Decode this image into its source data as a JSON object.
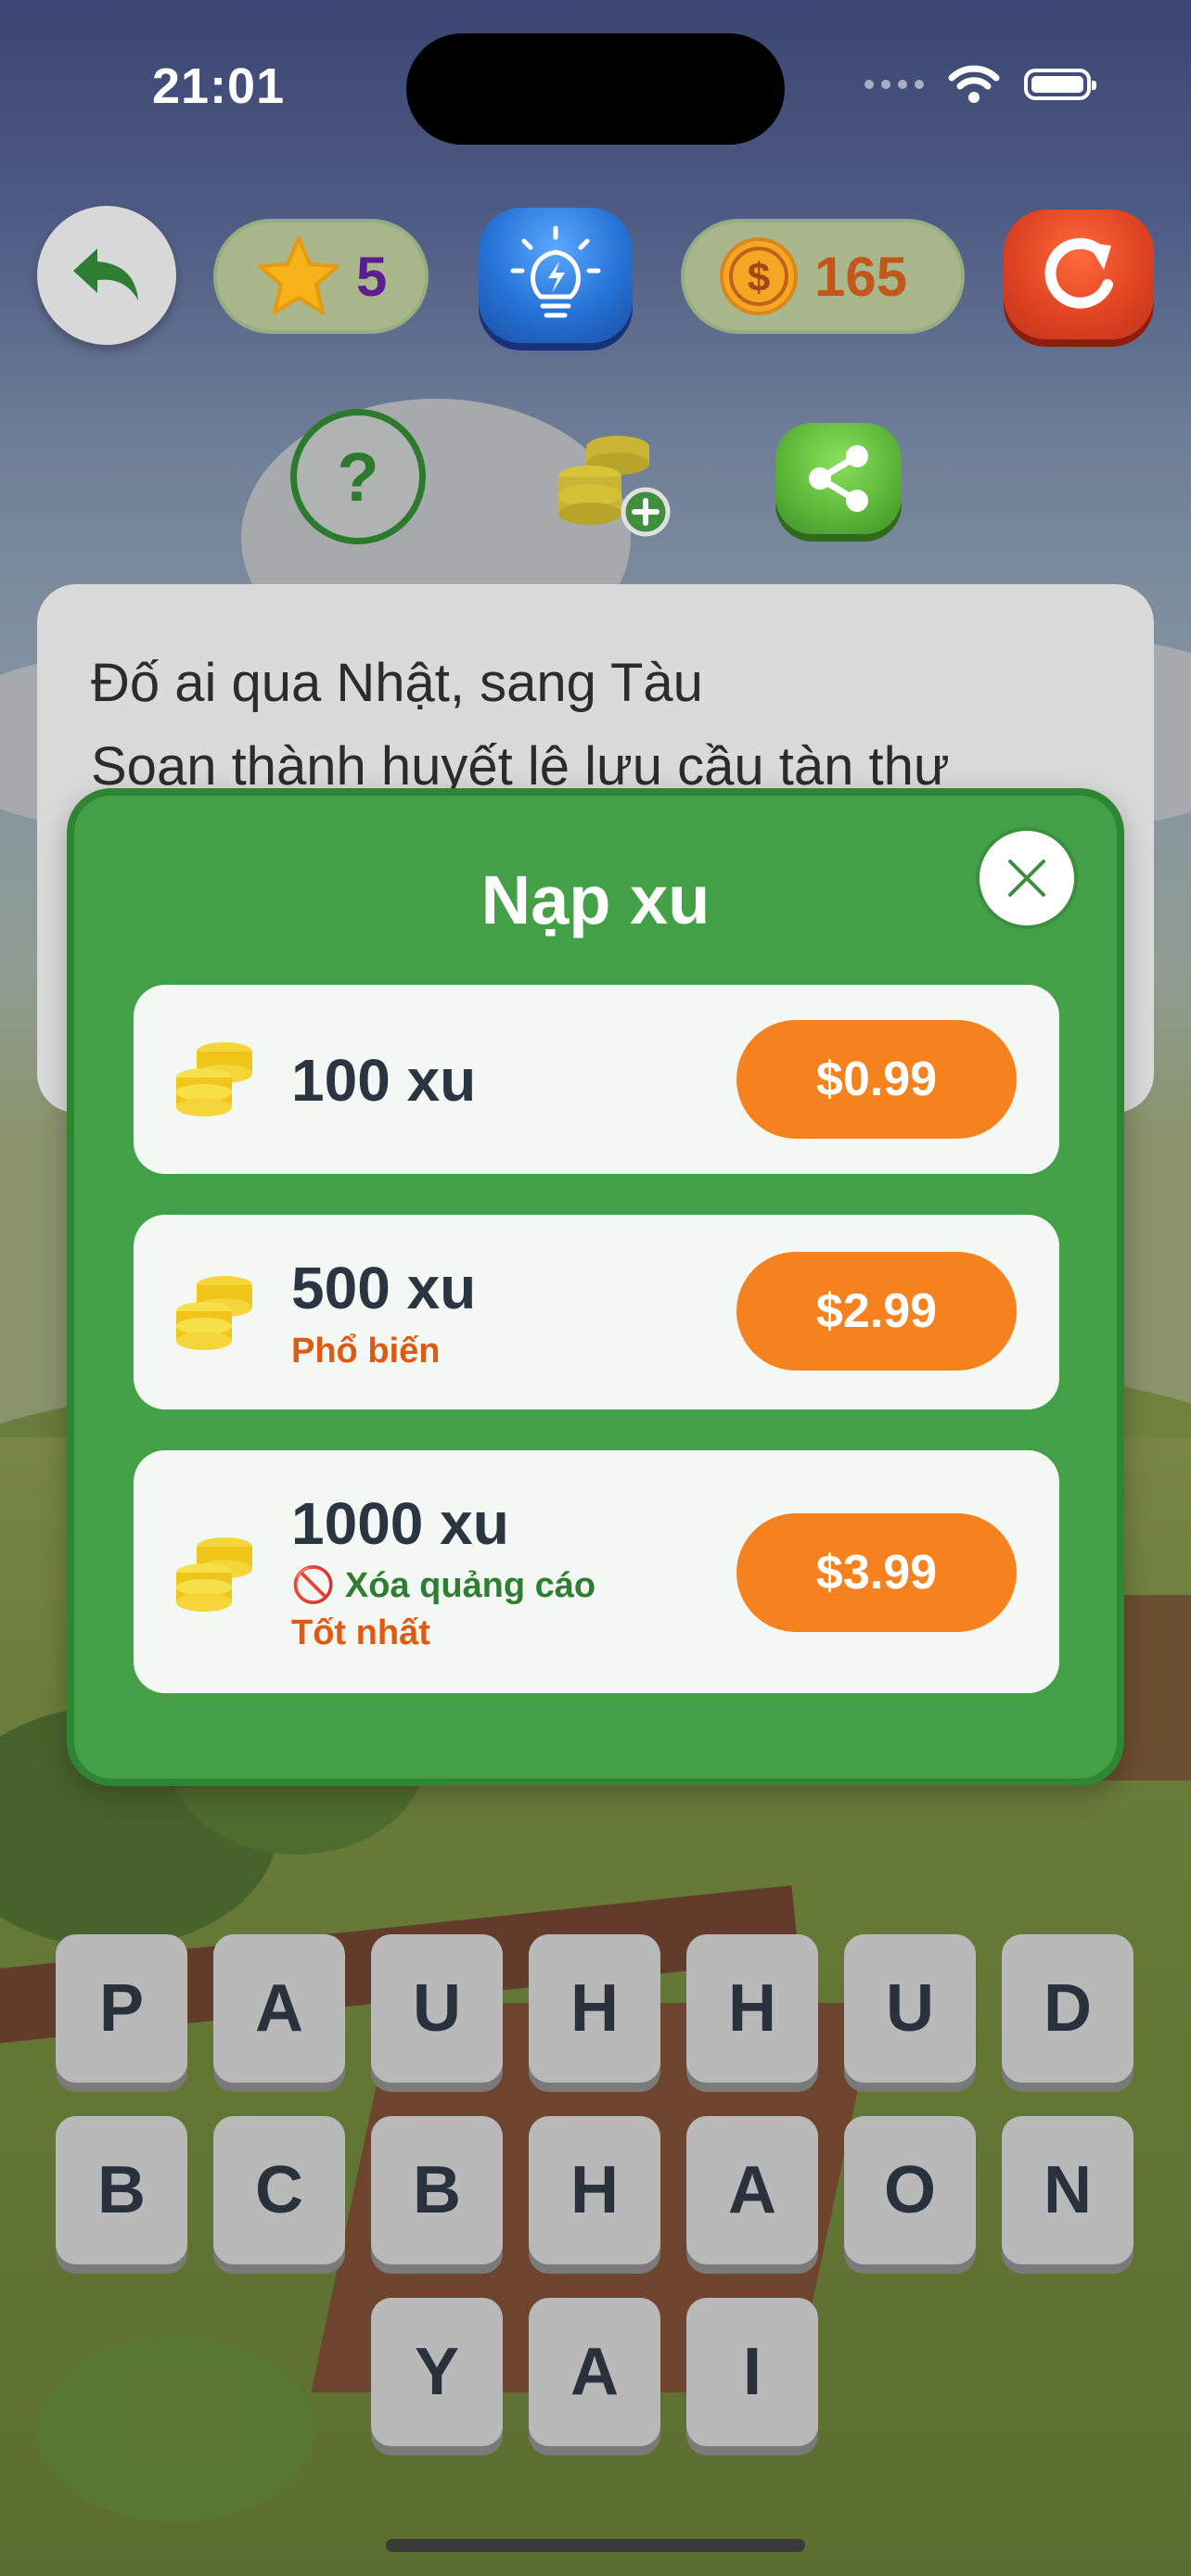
{
  "status_bar": {
    "time": "21:01"
  },
  "hud": {
    "stars": "5",
    "coins": "165"
  },
  "question": {
    "lines": [
      "Đố ai qua Nhật, sang Tàu",
      "Soạn thành huyết lệ lưu cầu tàn thư"
    ]
  },
  "modal": {
    "title": "Nạp xu",
    "packs": [
      {
        "name": "100 xu",
        "price": "$0.99"
      },
      {
        "name": "500 xu",
        "tag": "Phổ biến",
        "price": "$2.99"
      },
      {
        "name": "1000 xu",
        "benefit": "🚫 Xóa quảng cáo",
        "tag": "Tốt nhất",
        "price": "$3.99"
      }
    ]
  },
  "keyboard": {
    "row1": [
      "P",
      "A",
      "U",
      "H",
      "H",
      "U",
      "D"
    ],
    "row2": [
      "B",
      "C",
      "B",
      "H",
      "A",
      "O",
      "N"
    ],
    "row3": [
      "Y",
      "A",
      "I"
    ]
  },
  "icons": {
    "back": "back-arrow-icon",
    "star": "star-icon",
    "hint": "lightbulb-icon",
    "coin": "dollar-coin-icon",
    "reset": "refresh-icon",
    "help": "question-mark-icon",
    "coins_add": "coins-plus-icon",
    "share": "share-icon",
    "close": "close-icon"
  },
  "colors": {
    "modal_green": "#43a047",
    "price_orange": "#f5821f",
    "tag_orange": "#e05a12",
    "benefit_green": "#2e7d32",
    "star_count": "#5b1e91",
    "coin_count": "#c2571b"
  }
}
